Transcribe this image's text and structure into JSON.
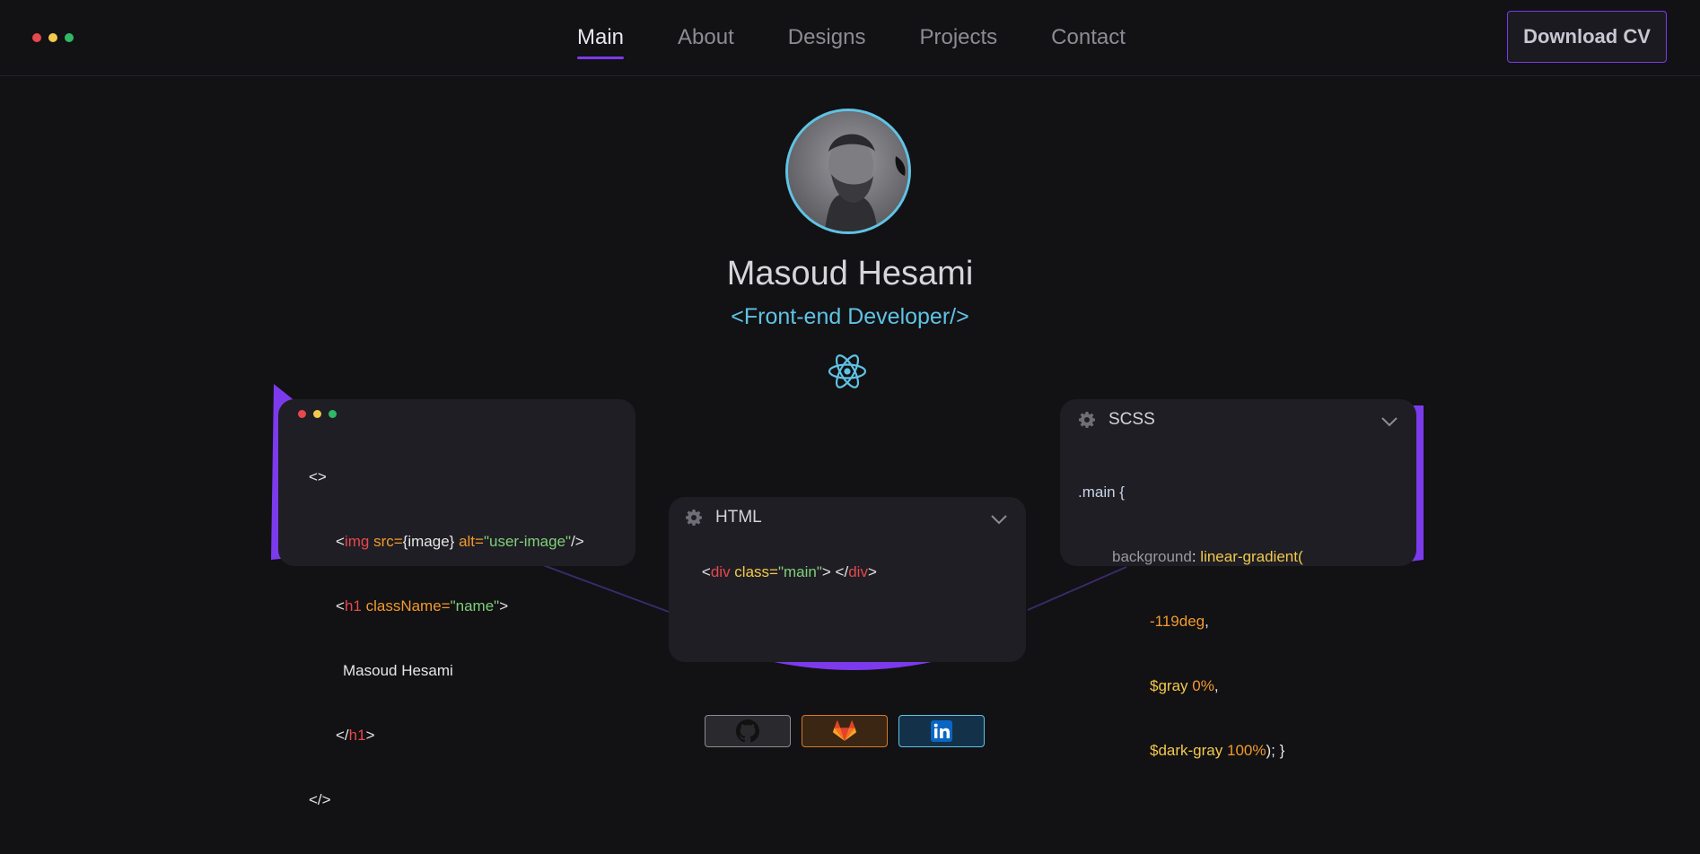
{
  "header": {
    "window_dots": [
      "#e5484d",
      "#f2c94c",
      "#30b866"
    ],
    "nav": [
      {
        "label": "Main",
        "active": true
      },
      {
        "label": "About",
        "active": false
      },
      {
        "label": "Designs",
        "active": false
      },
      {
        "label": "Projects",
        "active": false
      },
      {
        "label": "Contact",
        "active": false
      }
    ],
    "cta_label": "Download CV"
  },
  "profile": {
    "name": "Masoud Hesami",
    "role": "<Front-end Developer/>",
    "avatar_icon": "avatar-photo",
    "tech_icon": "react-icon"
  },
  "jsx_card": {
    "lines": {
      "l1": "<>",
      "l2_open": "<",
      "l2_tag": "img",
      "l2_attr1": " src",
      "l2_eq1": "=",
      "l2_val1": "{image}",
      "l2_attr2": " alt",
      "l2_eq2": "=",
      "l2_val2": "\"user-image\"",
      "l2_close": "/>",
      "l3_open": "<",
      "l3_tag": "h1",
      "l3_attr": " className",
      "l3_eq": "=",
      "l3_val": "\"name\"",
      "l3_close": ">",
      "l4": "Masoud Hesami",
      "l5_open": "</",
      "l5_tag": "h1",
      "l5_close": ">",
      "l6": "</>"
    }
  },
  "html_card": {
    "title": "HTML",
    "code": {
      "open": "<",
      "tag": "div",
      "attr": " class",
      "eq": "=",
      "val": "\"main\"",
      "mid": "> </",
      "tag2": "div",
      "close": ">"
    }
  },
  "scss_card": {
    "title": "SCSS",
    "code": {
      "sel": ".main {",
      "prop": "background",
      "colon": ": ",
      "fn": "linear-gradient(",
      "angle": "-119deg",
      "comma1": ",",
      "var1": "$gray",
      "pct1": " 0%",
      "comma2": ",",
      "var2": "$dark-gray",
      "pct2": " 100%",
      "end": "); }"
    }
  },
  "social": [
    {
      "name": "github-icon"
    },
    {
      "name": "gitlab-icon"
    },
    {
      "name": "linkedin-icon"
    }
  ],
  "colors": {
    "accent": "#7c3aed",
    "cyan": "#5fc3e4",
    "background": "#121114"
  }
}
